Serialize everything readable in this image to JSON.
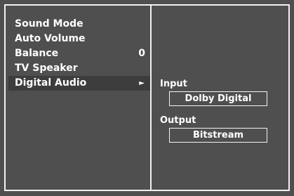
{
  "menu": {
    "items": [
      {
        "label": "Sound Mode",
        "value": ""
      },
      {
        "label": "Auto Volume",
        "value": ""
      },
      {
        "label": "Balance",
        "value": "0"
      },
      {
        "label": "TV Speaker",
        "value": ""
      },
      {
        "label": "Digital Audio",
        "value": "",
        "arrow": "►"
      }
    ],
    "selected_index": 4
  },
  "digital_audio": {
    "input_label": "Input",
    "input_value": "Dolby Digital",
    "output_label": "Output",
    "output_value": "Bitstream"
  },
  "colors": {
    "background": "#4f4f4f",
    "frame": "#f2f2f2",
    "selected_row": "#3d3d3d",
    "text": "#ffffff"
  },
  "icons": {
    "submenu_arrow": "right-triangle-icon"
  }
}
